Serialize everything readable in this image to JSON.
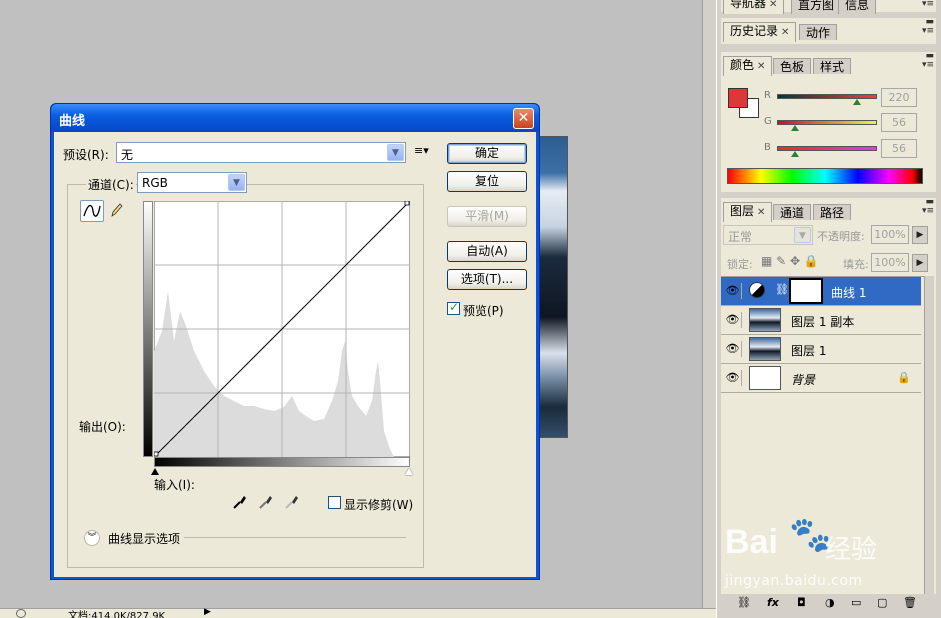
{
  "status_bar": {
    "doc_info": "文档:414.0K/827.9K"
  },
  "dialog": {
    "title": "曲线",
    "preset_label": "预设(R):",
    "preset_value": "无",
    "channel_label": "通道(C):",
    "channel_value": "RGB",
    "output_label": "输出(O):",
    "input_label": "输入(I):",
    "show_clipping_label": "显示修剪(W)",
    "curve_options_label": "曲线显示选项",
    "buttons": {
      "ok": "确定",
      "reset": "复位",
      "smooth": "平滑(M)",
      "auto": "自动(A)",
      "options": "选项(T)..."
    },
    "preview_label": "预览(P)",
    "preview_checked": true
  },
  "panels": {
    "nav_tabs": [
      "导航器",
      "直方图",
      "信息"
    ],
    "history_tabs": [
      "历史记录",
      "动作"
    ],
    "color_tabs": [
      "颜色",
      "色板",
      "样式"
    ],
    "color": {
      "r_label": "R",
      "g_label": "G",
      "b_label": "B",
      "r": "220",
      "g": "56",
      "b": "56",
      "fg_color": "#dc3838"
    },
    "layers_tabs": [
      "图层",
      "通道",
      "路径"
    ],
    "blend_mode": "正常",
    "opacity_label": "不透明度:",
    "opacity_value": "100%",
    "lock_label": "锁定:",
    "fill_label": "填充:",
    "fill_value": "100%",
    "layers": [
      {
        "name": "曲线 1",
        "type": "adjustment",
        "selected": true
      },
      {
        "name": "图层 1 副本",
        "type": "image",
        "selected": false
      },
      {
        "name": "图层 1",
        "type": "image",
        "selected": false
      },
      {
        "name": "背景",
        "type": "background",
        "selected": false,
        "locked": true
      }
    ]
  },
  "watermark": {
    "brand": "Bai",
    "brand2": "经验",
    "url": "jingyan.baidu.com"
  }
}
